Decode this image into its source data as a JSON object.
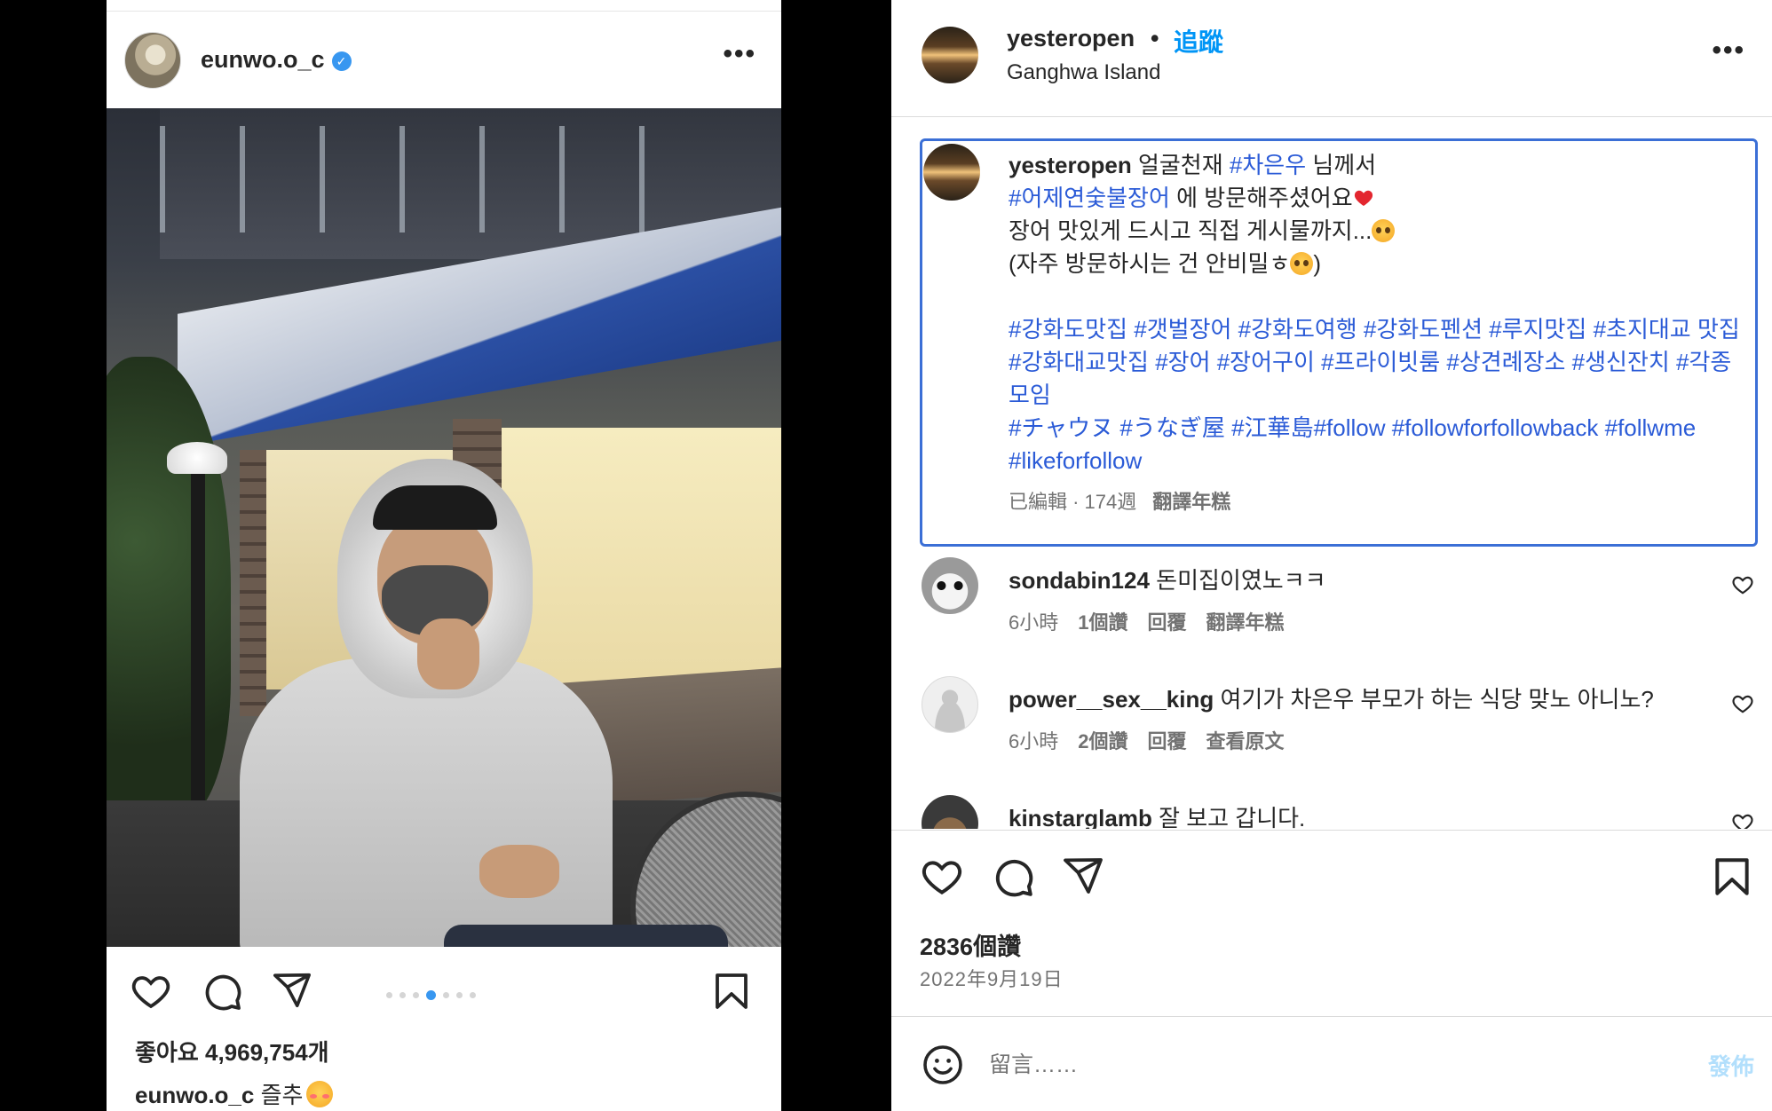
{
  "left_post": {
    "username": "eunwo.o_c",
    "likes_text": "좋아요 4,969,754개",
    "caption_user": "eunwo.o_c",
    "caption_text": "즐추",
    "carousel_dots": 6,
    "carousel_active_index": 3
  },
  "right_post": {
    "header": {
      "username": "yesteropen",
      "separator": "•",
      "follow_label": "追蹤",
      "location": "Ganghwa Island"
    },
    "caption": {
      "username": "yesteropen",
      "line1_text": "얼굴천재",
      "line1_tag": "#차은우",
      "line1_suffix": "님께서",
      "line2_tag": "#어제연숯불장어",
      "line2_suffix": "에 방문해주셨어요",
      "line3": "장어 맛있게 드시고 직접 게시물까지...",
      "line4_prefix": "(자주 방문하시는 건 안비밀ㅎ",
      "line4_suffix": ")",
      "hashtags_1": "#강화도맛집 #갯벌장어 #강화도여행 #강화도펜션 #루지맛집 #초지대교 맛집 #강화대교맛집 #장어 #장어구이 #프라이빗룸 #상견례장소 #생신잔치 #각종모임",
      "hashtags_2": "#チャウヌ #うなぎ屋 #江華島#follow #followforfollowback #follwme #likeforfollow",
      "meta_text": "已編輯 · 174週",
      "translate_label": "翻譯年糕"
    },
    "comments": [
      {
        "username": "sondabin124",
        "text": "돈미집이였노ㅋㅋ",
        "time": "6小時",
        "likes": "1個讚",
        "reply": "回覆",
        "extra": "翻譯年糕"
      },
      {
        "username": "power__sex__king",
        "text": "여기가 차은우 부모가 하는 식당 맞노 아니노?",
        "time": "6小時",
        "likes": "2個讚",
        "reply": "回覆",
        "extra": "查看原文"
      },
      {
        "username": "kinstarglamb",
        "text": "잘 보고 갑니다."
      }
    ],
    "likes_count": "2836個讚",
    "date": "2022年9月19日",
    "comment_placeholder": "留言……",
    "post_button": "發佈"
  },
  "colors": {
    "link_blue": "#0095f6",
    "hashtag_blue": "#2b5bd7",
    "highlight_border": "#3b6fd6",
    "muted_text": "#737373"
  },
  "icons": [
    "heart-icon",
    "comment-icon",
    "share-icon",
    "bookmark-icon",
    "more-icon",
    "verified-badge-icon",
    "emoji-icon"
  ]
}
